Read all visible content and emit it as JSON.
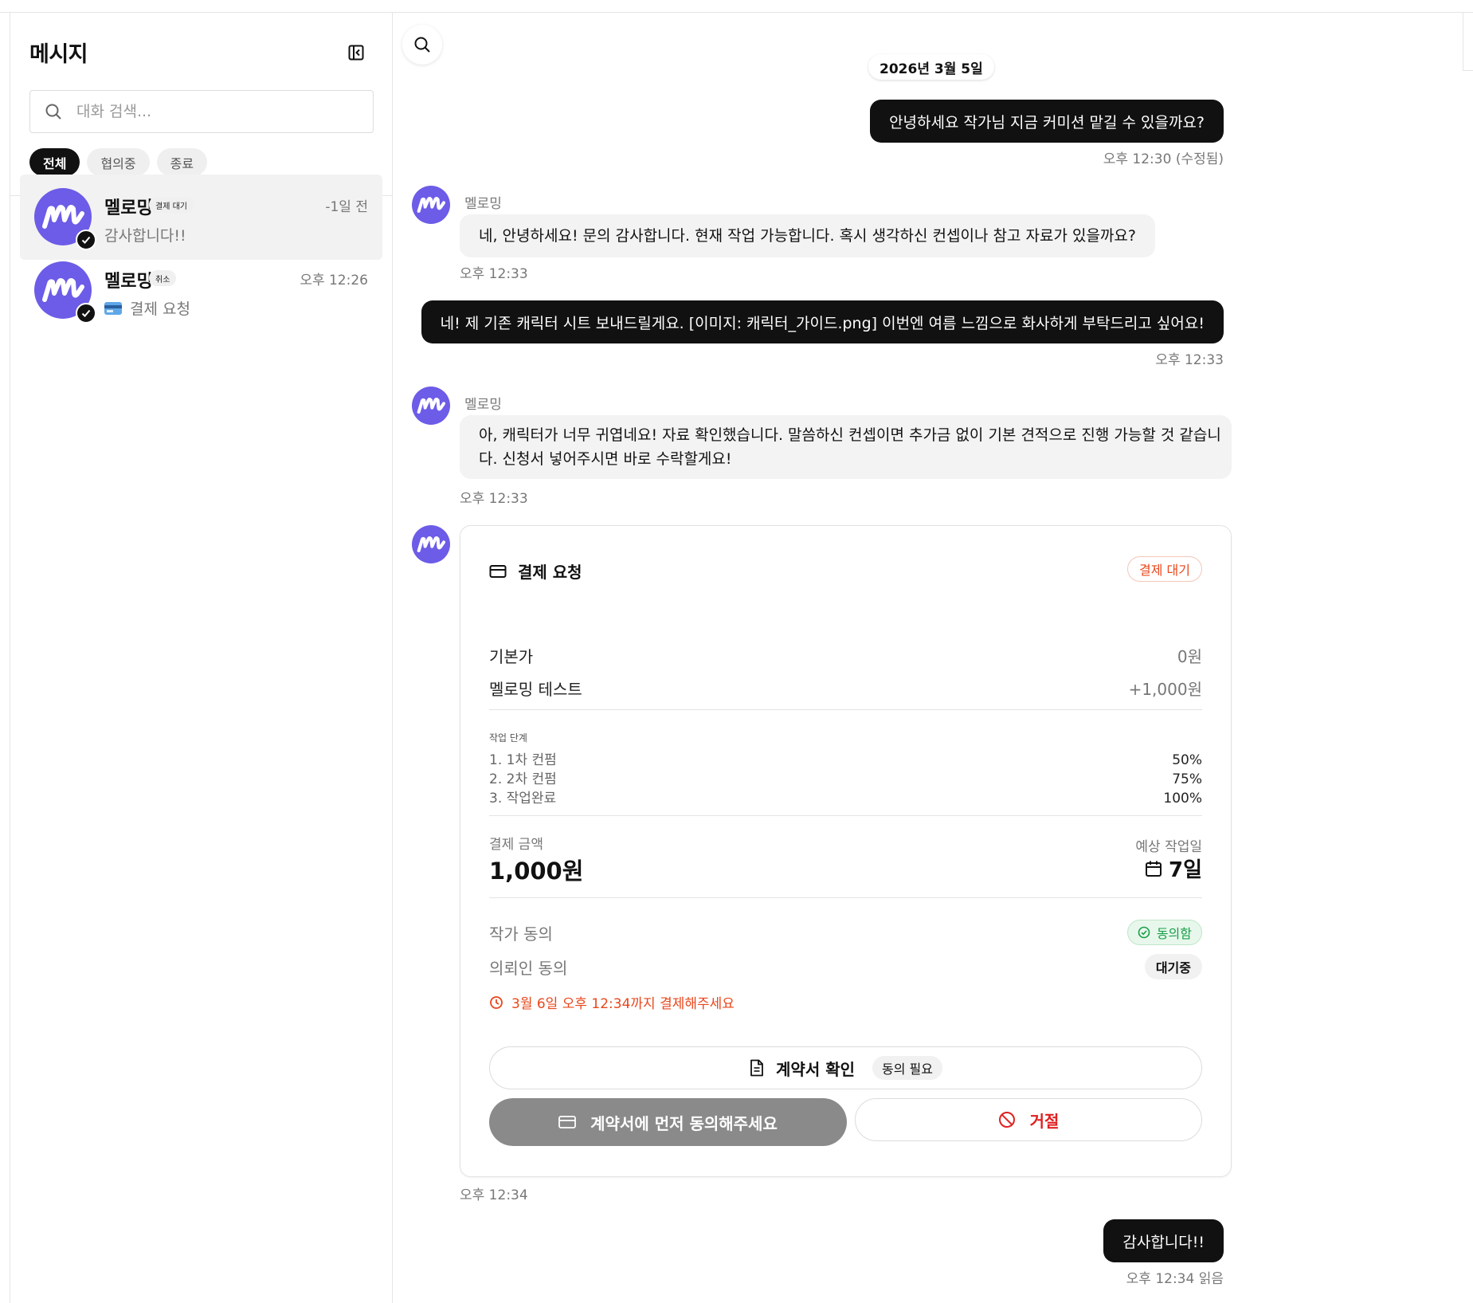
{
  "sidebar": {
    "title": "메시지",
    "search_placeholder": "대화 검색...",
    "filters": [
      "전체",
      "협의중",
      "종료"
    ],
    "conversations": [
      {
        "name": "멜로밍",
        "badge": "결제 대기",
        "time": "-1일 전",
        "preview": "감사합니다!!",
        "selected": true
      },
      {
        "name": "멜로밍",
        "badge": "취소",
        "time": "오후 12:26",
        "preview": "결제 요청",
        "preview_icon": "credit-card-emoji"
      }
    ]
  },
  "chat": {
    "date": "2026년 3월 5일",
    "messages": [
      {
        "dir": "out",
        "text": "안녕하세요 작가님 지금 커미션 맡길 수 있을까요?",
        "meta": "오후 12:30 (수정됨)"
      },
      {
        "dir": "in",
        "sender": "멜로밍",
        "text": "네, 안녕하세요! 문의 감사합니다. 현재 작업 가능합니다. 혹시 생각하신 컨셉이나 참고 자료가 있을까요?",
        "meta": "오후 12:33"
      },
      {
        "dir": "out",
        "text": "네! 제 기존 캐릭터 시트 보내드릴게요. [이미지: 캐릭터_가이드.png] 이번엔 여름 느낌으로 화사하게 부탁드리고 싶어요!",
        "meta": "오후 12:33"
      },
      {
        "dir": "in",
        "sender": "멜로밍",
        "text_line1": "아, 캐릭터가 너무 귀엽네요! 자료 확인했습니다. 말씀하신 컨셉이면 추가금 없이 기본 견적으로 진행 가능할 것 같습니",
        "text_line2": "다. 신청서 넣어주시면 바로 수락할게요!",
        "meta": "오후 12:33"
      },
      {
        "dir": "out",
        "text": "감사합니다!!",
        "meta": "오후 12:34 읽음"
      }
    ],
    "payment_card": {
      "title": "결제 요청",
      "status": "결제 대기",
      "base_label": "기본가",
      "base_value": "0원",
      "option_label": "멜로밍 테스트",
      "option_value": "+1,000원",
      "stage_title": "작업 단계",
      "stages": [
        {
          "name": "1. 1차 컨펌",
          "pct": "50%"
        },
        {
          "name": "2. 2차 컨펌",
          "pct": "75%"
        },
        {
          "name": "3. 작업완료",
          "pct": "100%"
        }
      ],
      "amount_label": "결제 금액",
      "amount_value": "1,000원",
      "days_label": "예상 작업일",
      "days_value": "7일",
      "artist_agree_label": "작가 동의",
      "artist_agree_status": "동의함",
      "client_agree_label": "의뢰인 동의",
      "client_agree_status": "대기중",
      "deadline": "3월 6일 오후 12:34까지 결제해주세요",
      "contract_button": "계약서 확인",
      "contract_chip": "동의 필요",
      "pay_button": "계약서에 먼저 동의해주세요",
      "reject_button": "거절",
      "meta": "오후 12:34"
    }
  },
  "colors": {
    "brand_purple": "#6c5ce7",
    "warning_orange": "#e8471c",
    "success_green": "#19a04a",
    "reject_red": "#e02020"
  }
}
